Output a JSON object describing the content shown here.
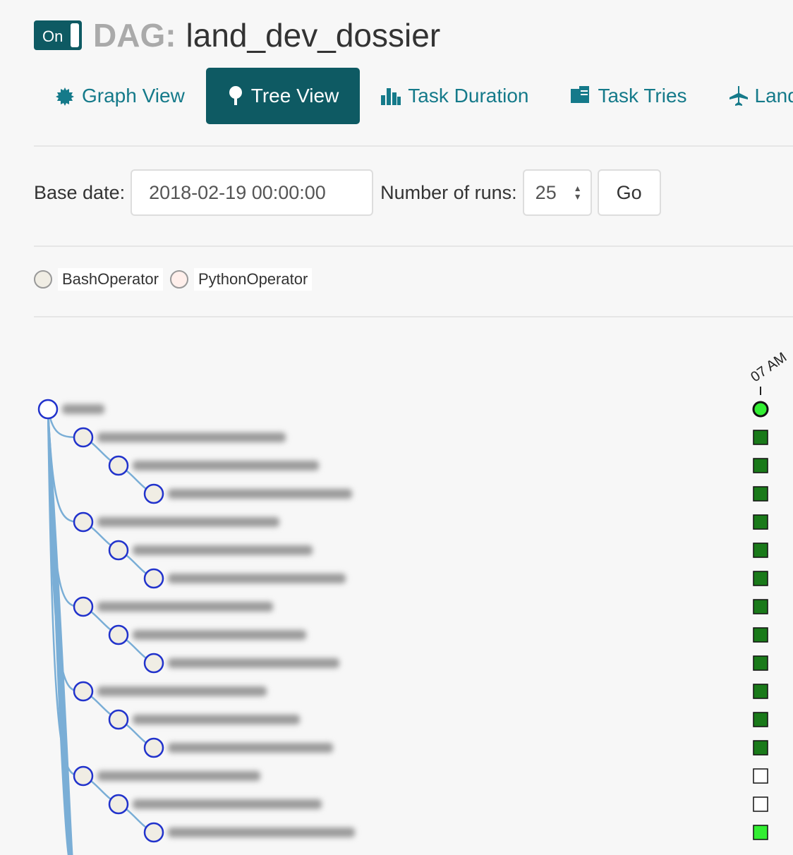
{
  "header": {
    "toggle_label": "On",
    "dag_prefix": "DAG:",
    "dag_name": "land_dev_dossier"
  },
  "tabs": [
    {
      "label": "Graph View",
      "icon": "gear-icon",
      "active": false
    },
    {
      "label": "Tree View",
      "icon": "tree-icon",
      "active": true
    },
    {
      "label": "Task Duration",
      "icon": "bar-chart-icon",
      "active": false
    },
    {
      "label": "Task Tries",
      "icon": "files-icon",
      "active": false
    },
    {
      "label": "Land",
      "icon": "plane-icon",
      "active": false
    }
  ],
  "form": {
    "base_date_label": "Base date:",
    "base_date_value": "2018-02-19 00:00:00",
    "num_runs_label": "Number of runs:",
    "num_runs_value": "25",
    "go_label": "Go"
  },
  "legend": [
    {
      "label": "BashOperator",
      "color": "#f0ede4"
    },
    {
      "label": "PythonOperator",
      "color": "#ffefeb"
    }
  ],
  "tree": {
    "time_label": "07 AM",
    "colors": {
      "node_stroke": "#2233cc",
      "node_fill": "#f0ede4",
      "link": "#7aaed6",
      "success": "#1a7a1a",
      "running": "#33ee33",
      "none": "#ffffff"
    },
    "root": {
      "state": "running"
    },
    "nodes": [
      {
        "depth": 1,
        "state": "success"
      },
      {
        "depth": 2,
        "state": "success"
      },
      {
        "depth": 3,
        "state": "success"
      },
      {
        "depth": 1,
        "state": "success"
      },
      {
        "depth": 2,
        "state": "success"
      },
      {
        "depth": 3,
        "state": "success"
      },
      {
        "depth": 1,
        "state": "success"
      },
      {
        "depth": 2,
        "state": "success"
      },
      {
        "depth": 3,
        "state": "success"
      },
      {
        "depth": 1,
        "state": "success"
      },
      {
        "depth": 2,
        "state": "success"
      },
      {
        "depth": 3,
        "state": "success"
      },
      {
        "depth": 1,
        "state": "none"
      },
      {
        "depth": 2,
        "state": "none"
      },
      {
        "depth": 3,
        "state": "running"
      }
    ]
  }
}
